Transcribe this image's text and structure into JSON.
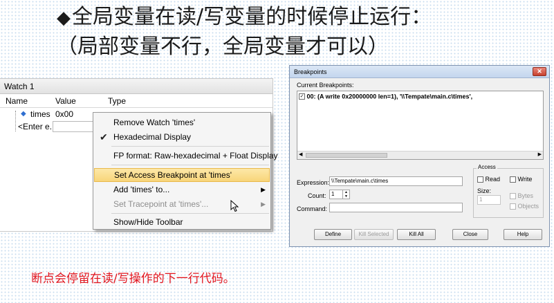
{
  "heading": {
    "bullet": "◆",
    "line1": "全局变量在读/写变量的时候停止运行：",
    "line2": "（局部变量不行，全局变量才可以）"
  },
  "watch": {
    "title": "Watch 1",
    "columns": [
      "Name",
      "Value",
      "Type"
    ],
    "rows": [
      {
        "name": "times",
        "value": "0x00",
        "type": ""
      },
      {
        "name": "<Enter e...",
        "value": "",
        "type": ""
      }
    ]
  },
  "context_menu": {
    "items": [
      {
        "label": "Remove Watch 'times'",
        "disabled": false
      },
      {
        "label": "Hexadecimal Display",
        "checked": true
      },
      {
        "label": "FP format: Raw-hexadecimal + Float Display"
      },
      {
        "label": "Set Access Breakpoint at 'times'",
        "highlighted": true
      },
      {
        "label": "Add 'times' to...",
        "submenu": true
      },
      {
        "label": "Set Tracepoint at 'times'...",
        "submenu": true,
        "disabled": true
      },
      {
        "label": "Show/Hide Toolbar"
      }
    ]
  },
  "breakpoints_dialog": {
    "title": "Breakpoints",
    "close_glyph": "✕",
    "current_label": "Current Breakpoints:",
    "entry": "00: (A write 0x20000000 len=1),  '\\\\Tempate\\main.c\\times',",
    "entry_checked": true,
    "expression_label": "Expression:",
    "expression_value": "\\\\Tempate\\main.c\\times",
    "count_label": "Count:",
    "count_value": "1",
    "command_label": "Command:",
    "command_value": "",
    "access_label": "Access",
    "read_label": "Read",
    "write_label": "Write",
    "size_label": "Size:",
    "size_value": "1",
    "bytes_label": "Bytes",
    "objects_label": "Objects",
    "buttons": {
      "define": "Define",
      "kill_selected": "Kill Selected",
      "kill_all": "Kill All",
      "close": "Close",
      "help": "Help"
    }
  },
  "note": "断点会停留在读/写操作的下一行代码。",
  "colors": {
    "note_red": "#e2161f",
    "menu_highlight": "#f8d57a",
    "dialog_title": "#c3d6ee"
  },
  "icons": [
    "variable-icon",
    "check-icon",
    "submenu-arrow-icon",
    "mouse-pointer-icon",
    "close-icon",
    "spin-up-icon",
    "spin-down-icon"
  ]
}
